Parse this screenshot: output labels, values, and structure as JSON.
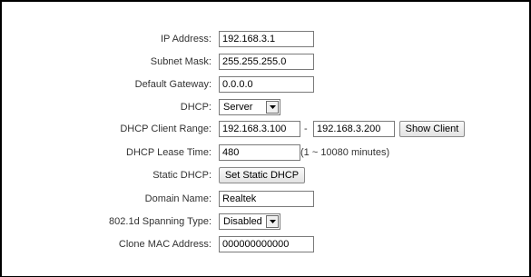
{
  "form": {
    "ip_address": {
      "label": "IP Address:",
      "value": "192.168.3.1"
    },
    "subnet_mask": {
      "label": "Subnet Mask:",
      "value": "255.255.255.0"
    },
    "default_gateway": {
      "label": "Default Gateway:",
      "value": "0.0.0.0"
    },
    "dhcp": {
      "label": "DHCP:",
      "selected": "Server"
    },
    "dhcp_client_range": {
      "label": "DHCP Client Range:",
      "start": "192.168.3.100",
      "separator": "-",
      "end": "192.168.3.200",
      "button": "Show Client"
    },
    "dhcp_lease_time": {
      "label": "DHCP Lease Time:",
      "value": "480",
      "hint": "(1 ~ 10080 minutes)"
    },
    "static_dhcp": {
      "label": "Static DHCP:",
      "button": "Set Static DHCP"
    },
    "domain_name": {
      "label": "Domain Name:",
      "value": "Realtek"
    },
    "spanning_type": {
      "label": "802.1d Spanning Type:",
      "selected": "Disabled"
    },
    "clone_mac": {
      "label": "Clone MAC Address:",
      "value": "000000000000"
    }
  },
  "icons": {
    "dropdown": "chevron-down-icon"
  }
}
